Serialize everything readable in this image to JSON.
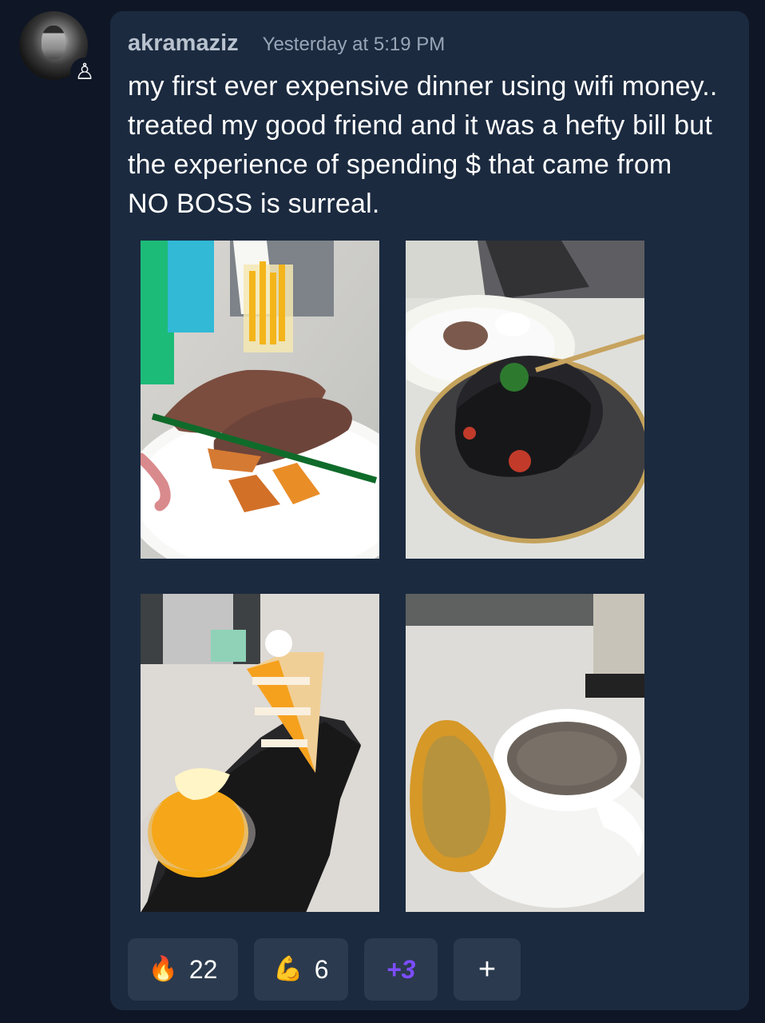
{
  "post": {
    "username": "akramaziz",
    "timestamp": "Yesterday at 5:19 PM",
    "message": "my first ever expensive dinner using wifi money.. treated my good friend and it was a hefty bill but the experience of spending $ that came from NO BOSS is surreal."
  },
  "icons": {
    "role": "chess-pawn-icon",
    "avatar": "profile-photo",
    "reaction_fire": "fire-icon",
    "reaction_strong": "flexed-biceps-icon",
    "add": "plus-icon"
  },
  "reactions": {
    "fire": "🔥",
    "fire_count": "22",
    "strong": "💪",
    "strong_count": "6",
    "more": "+3",
    "add": "+"
  },
  "images": [
    {
      "description": "Steak with roasted vegetables and fries"
    },
    {
      "description": "Black squid ink pasta with mussels"
    },
    {
      "description": "Mango cake and dessert"
    },
    {
      "description": "Mushroom soup with garlic bread"
    }
  ],
  "colors": {
    "background": "#0f1726",
    "card": "#1b2a3f",
    "reaction": "#2b3a4e",
    "muted_text": "#b9c2cf",
    "accent": "#7c4dff"
  }
}
